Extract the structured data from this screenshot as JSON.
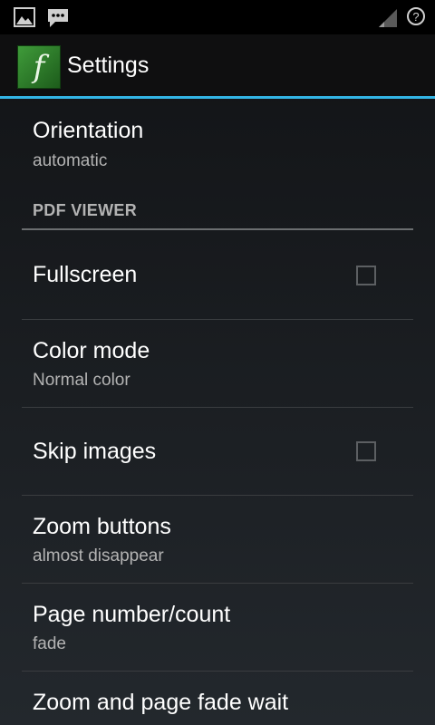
{
  "status_bar": {
    "icons": [
      "gallery-icon",
      "message-icon",
      "signal-icon",
      "help-icon"
    ],
    "help_glyph": "?"
  },
  "action_bar": {
    "app_icon_glyph": "f",
    "title": "Settings",
    "accent_color": "#33b5e5"
  },
  "preferences": {
    "orientation": {
      "label": "Orientation",
      "summary": "automatic"
    },
    "category_pdf": "PDF VIEWER",
    "fullscreen": {
      "label": "Fullscreen",
      "checked": false
    },
    "color_mode": {
      "label": "Color mode",
      "summary": "Normal color"
    },
    "skip_images": {
      "label": "Skip images",
      "checked": false
    },
    "zoom_buttons": {
      "label": "Zoom buttons",
      "summary": "almost disappear"
    },
    "page_number": {
      "label": "Page number/count",
      "summary": "fade"
    },
    "zoom_fade_wait": {
      "label": "Zoom and page fade wait"
    }
  }
}
